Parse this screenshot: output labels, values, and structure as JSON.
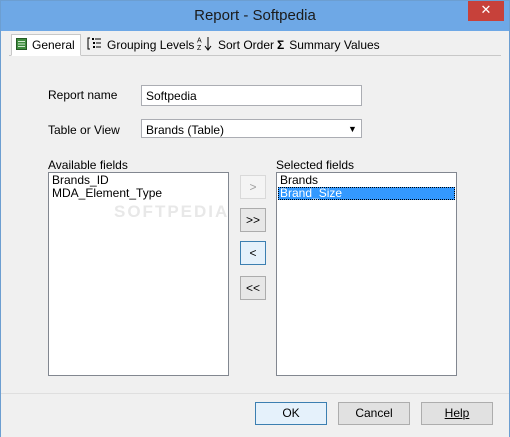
{
  "window": {
    "title": "Report - Softpedia",
    "close_glyph": "✕"
  },
  "tabs": [
    {
      "label": "General",
      "icon": "general-icon",
      "active": true
    },
    {
      "label": "Grouping Levels",
      "icon": "grouping-levels-icon",
      "active": false
    },
    {
      "label": "Sort Order",
      "icon": "sort-order-icon",
      "active": false
    },
    {
      "label": "Summary Values",
      "icon": "summary-values-icon",
      "active": false
    }
  ],
  "general": {
    "report_name_label": "Report name",
    "report_name_value": "Softpedia",
    "table_or_view_label": "Table or View",
    "table_or_view_value": "Brands (Table)",
    "available_fields_label": "Available fields",
    "available_fields": [
      "Brands_ID",
      "MDA_Element_Type"
    ],
    "selected_fields_label": "Selected fields",
    "selected_fields": [
      "Brands",
      "Brand_Size"
    ],
    "selected_index": 1,
    "watermark": "SOFTPEDIA"
  },
  "move_buttons": {
    "add_one": ">",
    "add_all": ">>",
    "remove_one": "<",
    "remove_all": "<<"
  },
  "footer": {
    "ok": "OK",
    "cancel": "Cancel",
    "help": "Help"
  },
  "colors": {
    "titlebar": "#6ea8e6",
    "close": "#c7413a",
    "selection": "#3399ff"
  }
}
